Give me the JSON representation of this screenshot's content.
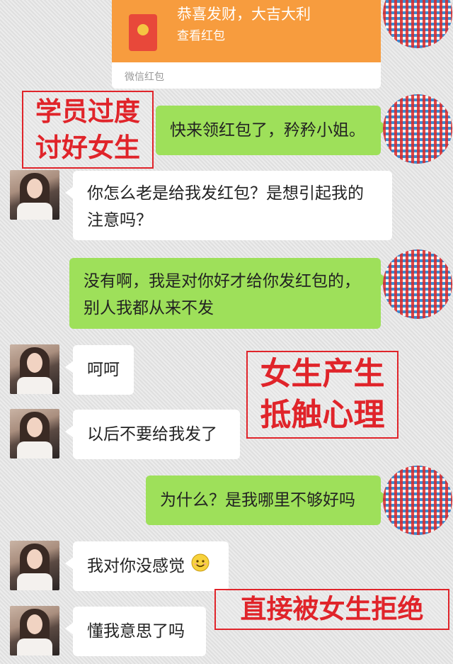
{
  "red_packet": {
    "title": "恭喜发财，大吉大利",
    "subtitle": "查看红包",
    "footer": "微信红包"
  },
  "messages": [
    {
      "from": "me",
      "text": "快来领红包了，矜矜小姐。"
    },
    {
      "from": "other",
      "lines": [
        "你怎么老是给我发红包？是想引起我的",
        "注意吗？"
      ]
    },
    {
      "from": "me",
      "lines": [
        "没有啊，我是对你好才给你发红包的，",
        "别人我都从来不发"
      ]
    },
    {
      "from": "other",
      "text": "呵呵"
    },
    {
      "from": "other",
      "text": "以后不要给我发了"
    },
    {
      "from": "me",
      "text": "为什么？是我哪里不够好吗"
    },
    {
      "from": "other",
      "text": "我对你没感觉",
      "emoji": "smile-emoji"
    },
    {
      "from": "other",
      "text": "懂我意思了吗"
    }
  ],
  "annotations": [
    {
      "lines": [
        "学员过度",
        "讨好女生"
      ]
    },
    {
      "lines": [
        "女生产生",
        "抵触心理"
      ]
    },
    {
      "lines": [
        "直接被女生拒绝"
      ]
    }
  ],
  "colors": {
    "bubble_me": "#9ee05a",
    "bubble_other": "#ffffff",
    "red_packet": "#f79c3e",
    "annotation_red": "#e0242a"
  }
}
